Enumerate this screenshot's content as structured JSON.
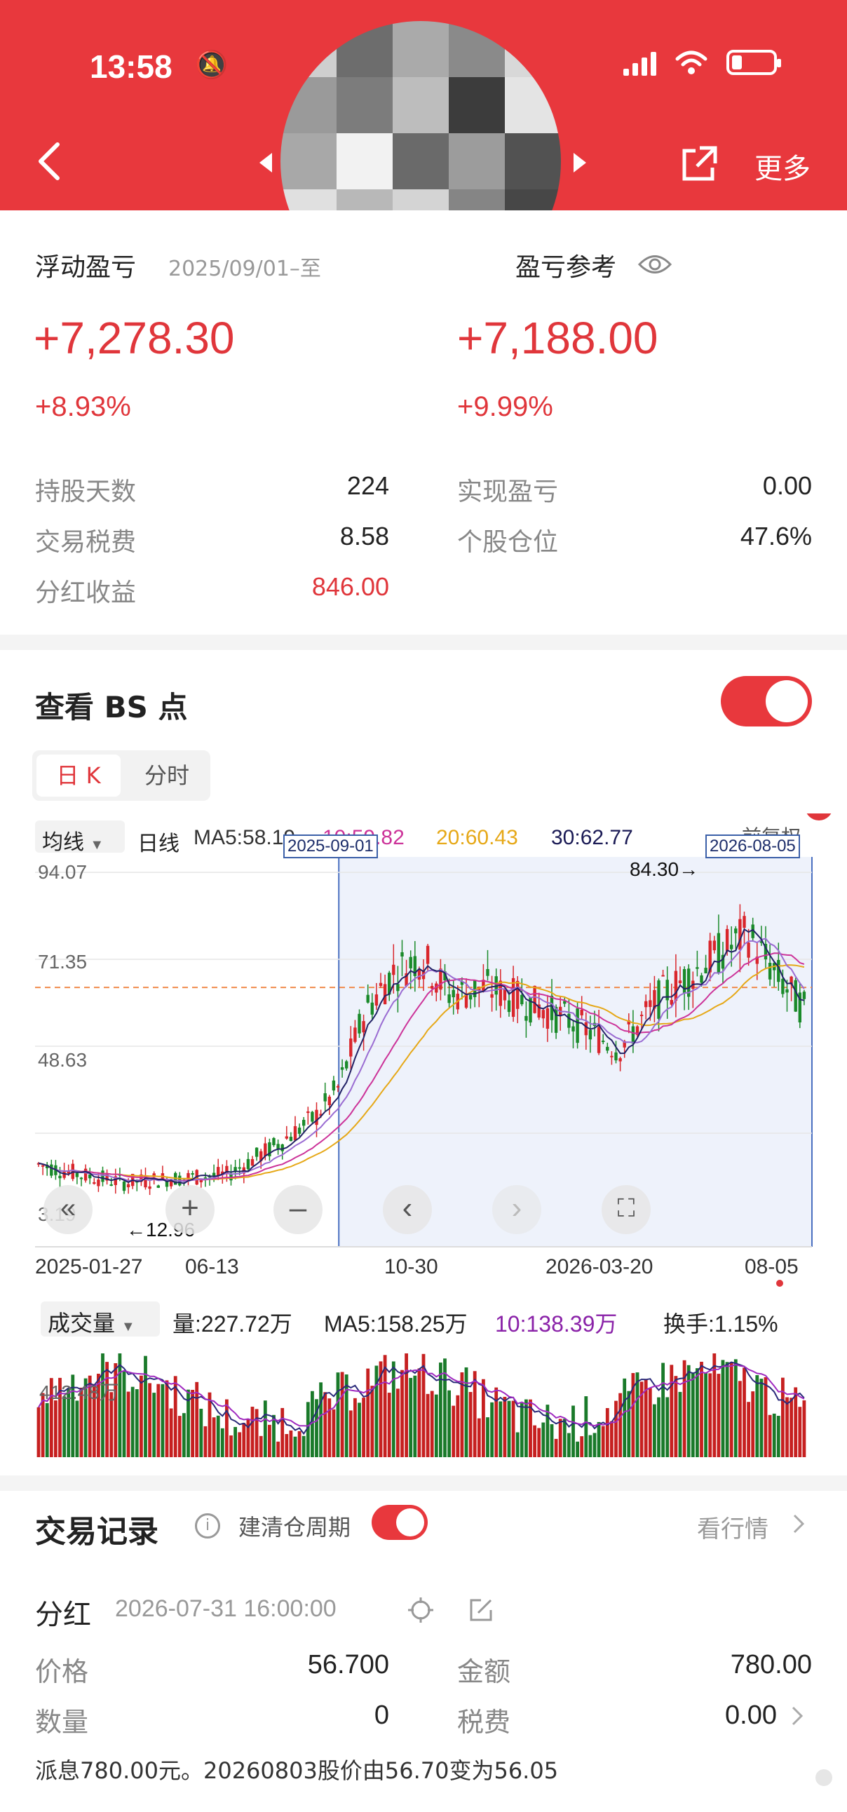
{
  "status_bar": {
    "time": "13:58"
  },
  "header": {
    "more_label": "更多"
  },
  "summary": {
    "floating_pnl_label": "浮动盈亏",
    "date_range": "2025/09/01–至",
    "pnl_ref_label": "盈亏参考",
    "floating_pnl_value": "+7,278.30",
    "floating_pnl_pct": "+8.93%",
    "ref_pnl_value": "+7,188.00",
    "ref_pnl_pct": "+9.99%",
    "rows_left": [
      {
        "label": "持股天数",
        "value": "224"
      },
      {
        "label": "交易税费",
        "value": "8.58"
      },
      {
        "label": "分红收益",
        "value": "846.00"
      }
    ],
    "rows_right": [
      {
        "label": "实现盈亏",
        "value": "0.00"
      },
      {
        "label": "个股仓位",
        "value": "47.6%"
      }
    ]
  },
  "bs_section": {
    "title": "查看 BS 点",
    "toggle_on": true,
    "tabs": [
      "日 K",
      "分时"
    ],
    "active_tab": "日 K"
  },
  "kline": {
    "indicator_select": "均线",
    "period": "日线",
    "ma5": "MA5:58.19",
    "ma10": "10:59.82",
    "ma20": "20:60.43",
    "ma30": "30:62.77",
    "fq_label": "前复权",
    "range_start_tag": "2025-09-01",
    "range_end_tag": "2026-08-05",
    "y_ticks": [
      "94.07",
      "71.35",
      "48.63",
      "3.19"
    ],
    "high_label": "84.30→",
    "low_label": "←12.96",
    "x_ticks": [
      "2025-01-27",
      "06-13",
      "10-30",
      "2026-03-20",
      "08-05"
    ],
    "controls": [
      "«",
      "+",
      "–",
      "‹",
      "›",
      "⛶"
    ],
    "colors": {
      "up": "#d9262c",
      "down": "#1a8a2a",
      "ma5": "#222266",
      "ma10": "#cc3399",
      "ma20": "#e6a817",
      "ma30": "#1a1a55",
      "sell_badge": "#2e9e3e",
      "buy_badge": "#e0363b"
    }
  },
  "volume": {
    "indicator_select": "成交量",
    "vol": "量:227.72万",
    "ma5": "MA5:158.25万",
    "ma10": "10:138.39万",
    "turnover": "换手:1.15%",
    "y_tick": "412.48万"
  },
  "chart_data": {
    "type": "candlestick",
    "x_range": [
      "2025-01-27",
      "2026-08-05"
    ],
    "ylim": [
      3.19,
      94.07
    ],
    "highlight_range": [
      "2025-09-01",
      "2026-08-05"
    ],
    "approx_close": [
      [
        "2025-01-27",
        18
      ],
      [
        "2025-03-01",
        15
      ],
      [
        "2025-04-01",
        13
      ],
      [
        "2025-05-01",
        14
      ],
      [
        "2025-06-13",
        15
      ],
      [
        "2025-07-15",
        22
      ],
      [
        "2025-08-15",
        30
      ],
      [
        "2025-09-01",
        38
      ],
      [
        "2025-09-20",
        58
      ],
      [
        "2025-10-10",
        68
      ],
      [
        "2025-10-30",
        72
      ],
      [
        "2025-11-20",
        62
      ],
      [
        "2025-12-15",
        64
      ],
      [
        "2026-01-15",
        60
      ],
      [
        "2026-02-15",
        55
      ],
      [
        "2026-03-20",
        48
      ],
      [
        "2026-04-20",
        62
      ],
      [
        "2026-05-20",
        70
      ],
      [
        "2026-06-20",
        78
      ],
      [
        "2026-07-15",
        65
      ],
      [
        "2026-08-05",
        56
      ]
    ],
    "marked_high": 84.3,
    "marked_low": 12.96
  },
  "trade_records": {
    "title": "交易记录",
    "cycle_label": "建清仓周期",
    "view_market": "看行情",
    "item": {
      "type": "分红",
      "time": "2026-07-31 16:00:00",
      "price_label": "价格",
      "price": "56.700",
      "amount_label": "金额",
      "amount": "780.00",
      "qty_label": "数量",
      "qty": "0",
      "tax_label": "税费",
      "tax": "0.00",
      "note": "派息780.00元。20260803股价由56.70变为56.05"
    }
  }
}
